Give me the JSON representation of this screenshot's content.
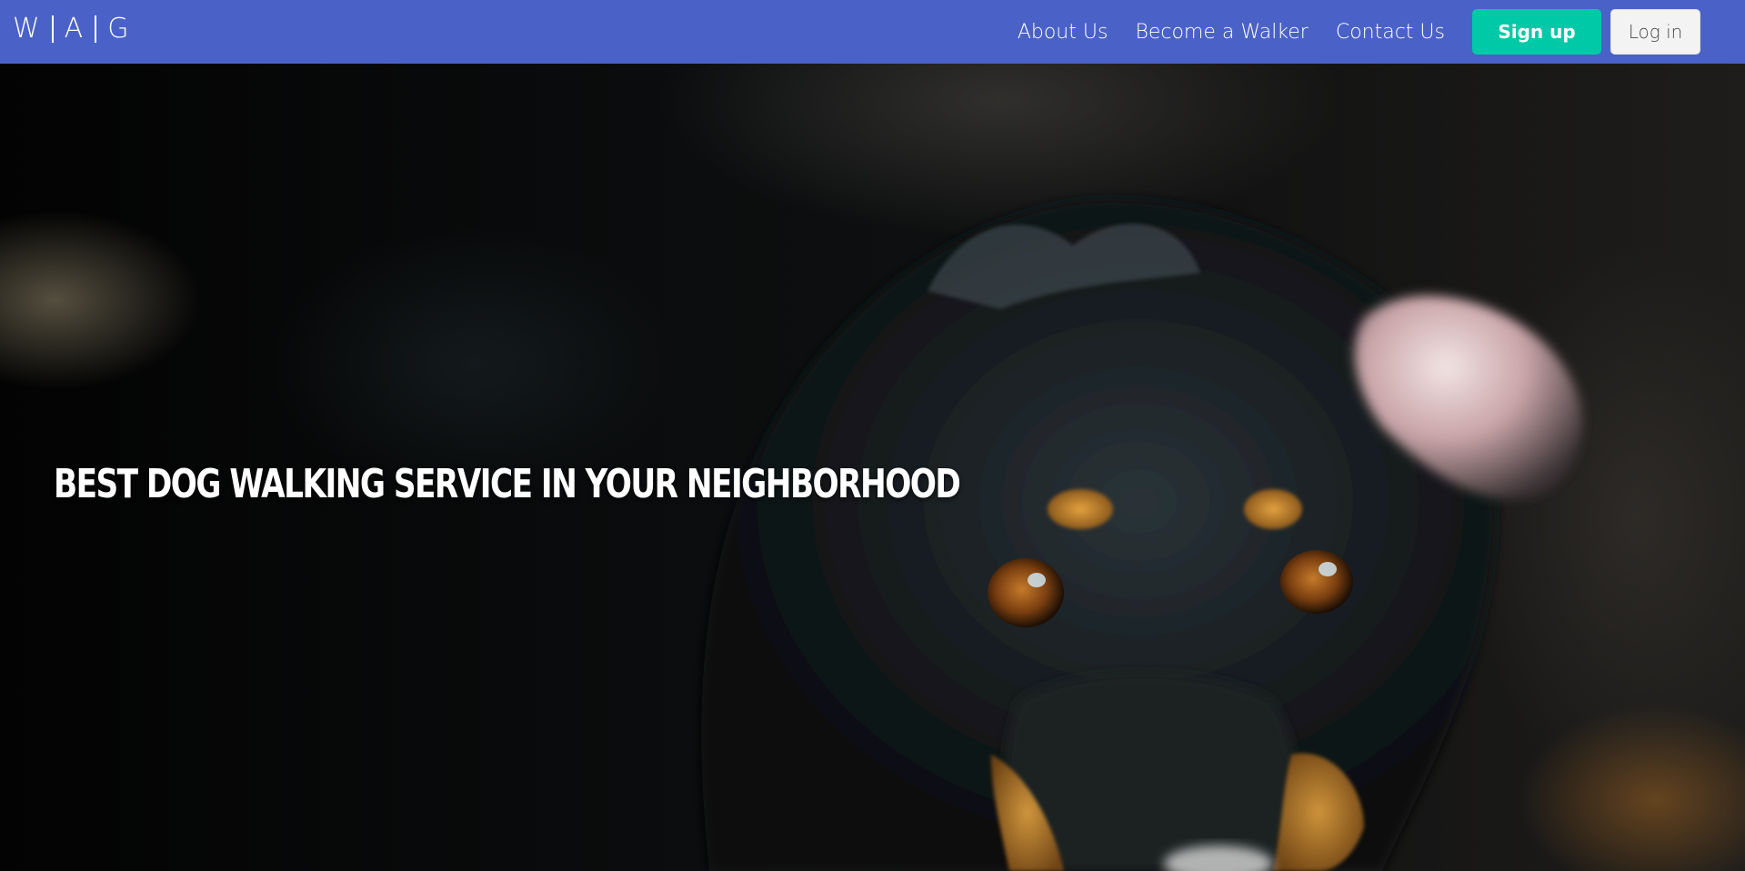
{
  "brand": {
    "letters": [
      "W",
      "A",
      "G"
    ]
  },
  "nav": {
    "links": [
      "About Us",
      "Become a Walker",
      "Contact Us"
    ],
    "signup_label": "Sign up",
    "login_label": "Log in"
  },
  "hero": {
    "title": "BEST DOG WALKING SERVICE IN YOUR NEIGHBORHOOD"
  },
  "colors": {
    "navbar": "#4a62c8",
    "signup_button": "#00c9a7",
    "login_button": "#f3f3f3"
  }
}
